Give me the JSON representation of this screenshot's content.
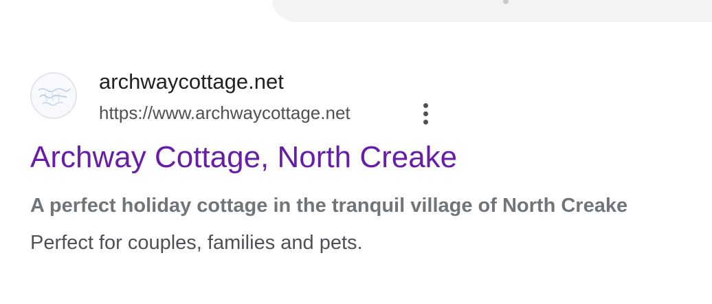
{
  "search_result": {
    "site_name": "archwaycottage.net",
    "url": "https://www.archwaycottage.net",
    "title": "Archway Cottage, North Creake",
    "snippet_bold": "A perfect holiday cottage in the tranquil village of North Creake",
    "snippet_text": "Perfect for couples, families and pets.",
    "favicon_icon": "cottage-logo-icon",
    "more_icon": "more-vert-icon"
  },
  "colors": {
    "title_link": "#681da8",
    "site_name": "#202124",
    "url": "#4d5156",
    "snippet_bold": "#70757a",
    "top_bar": "#f1f3f4"
  }
}
